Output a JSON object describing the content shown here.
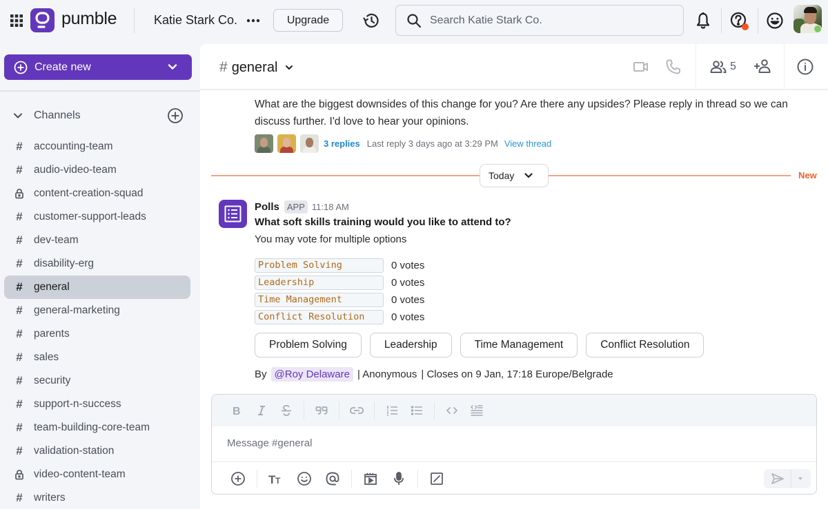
{
  "app": {
    "brand": "pumble",
    "brand_color": "#6237bc",
    "workspace_name": "Katie Stark Co.",
    "upgrade_label": "Upgrade",
    "search_placeholder": "Search Katie Stark Co.",
    "icons": {
      "apps": "grid-icon",
      "more": "ellipsis-icon",
      "history": "history-icon",
      "search": "search-icon",
      "notifications": "bell-icon",
      "help": "help-icon",
      "status": "smiley-icon",
      "profile": "avatar"
    },
    "help_badge_color": "#f5541d",
    "online_color": "#7cc860"
  },
  "sidebar": {
    "create_new_label": "Create new",
    "channels_label": "Channels",
    "channels": [
      {
        "name": "accounting-team",
        "icon": "hash",
        "active": false
      },
      {
        "name": "audio-video-team",
        "icon": "hash",
        "active": false
      },
      {
        "name": "content-creation-squad",
        "icon": "lock",
        "active": false
      },
      {
        "name": "customer-support-leads",
        "icon": "hash",
        "active": false
      },
      {
        "name": "dev-team",
        "icon": "hash",
        "active": false
      },
      {
        "name": "disability-erg",
        "icon": "hash",
        "active": false
      },
      {
        "name": "general",
        "icon": "hash",
        "active": true
      },
      {
        "name": "general-marketing",
        "icon": "hash",
        "active": false
      },
      {
        "name": "parents",
        "icon": "hash",
        "active": false
      },
      {
        "name": "sales",
        "icon": "hash",
        "active": false
      },
      {
        "name": "security",
        "icon": "hash",
        "active": false
      },
      {
        "name": "support-n-success",
        "icon": "hash",
        "active": false
      },
      {
        "name": "team-building-core-team",
        "icon": "hash",
        "active": false
      },
      {
        "name": "validation-station",
        "icon": "hash",
        "active": false
      },
      {
        "name": "video-content-team",
        "icon": "lock",
        "active": false
      },
      {
        "name": "writers",
        "icon": "hash",
        "active": false
      }
    ]
  },
  "channel_header": {
    "hash": "#",
    "name": "general",
    "members_count": "5"
  },
  "messages": {
    "previous": {
      "text": "What are the biggest downsides of this change for you? Are there any upsides? Please reply in thread so we can discuss further. I'd love to hear your opinions.",
      "replies_label": "3 replies",
      "last_reply": "Last reply 3 days ago at 3:29 PM",
      "view_thread_label": "View thread"
    },
    "divider": {
      "label": "Today",
      "new_label": "New",
      "line_color": "#f4a185",
      "new_color": "#f0622e"
    },
    "poll": {
      "author": "Polls",
      "badge": "APP",
      "time": "11:18 AM",
      "question": "What soft skills training would you like to attend to?",
      "subtitle": "You may vote for multiple options",
      "options": [
        {
          "label": "Problem Solving",
          "votes": "0 votes"
        },
        {
          "label": "Leadership",
          "votes": "0 votes"
        },
        {
          "label": "Time Management",
          "votes": "0 votes"
        },
        {
          "label": "Conflict Resolution",
          "votes": "0 votes"
        }
      ],
      "by_label": "By",
      "creator": "@Roy Delaware",
      "anonymous": "| Anonymous",
      "closes": "| Closes on 9 Jan, 17:18 Europe/Belgrade"
    }
  },
  "composer": {
    "placeholder": "Message #general",
    "format_tools": [
      "bold",
      "italic",
      "strikethrough",
      "quote",
      "link",
      "ordered-list",
      "bullet-list",
      "code",
      "code-block"
    ],
    "action_tools": [
      "attach",
      "text-format",
      "emoji",
      "mention",
      "gif",
      "voice",
      "slash-command"
    ]
  }
}
